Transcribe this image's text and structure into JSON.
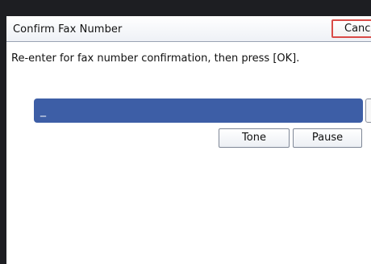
{
  "header": {
    "title": "Confirm Fax Number",
    "cancel_label": "Cancel"
  },
  "main": {
    "instruction": "Re-enter for fax number confirmation, then press [OK].",
    "fax_entry_value": "_",
    "keys": {
      "tone": "Tone",
      "pause": "Pause"
    }
  },
  "colors": {
    "input_background": "#3d5ea6",
    "cancel_border": "#d94b47"
  }
}
